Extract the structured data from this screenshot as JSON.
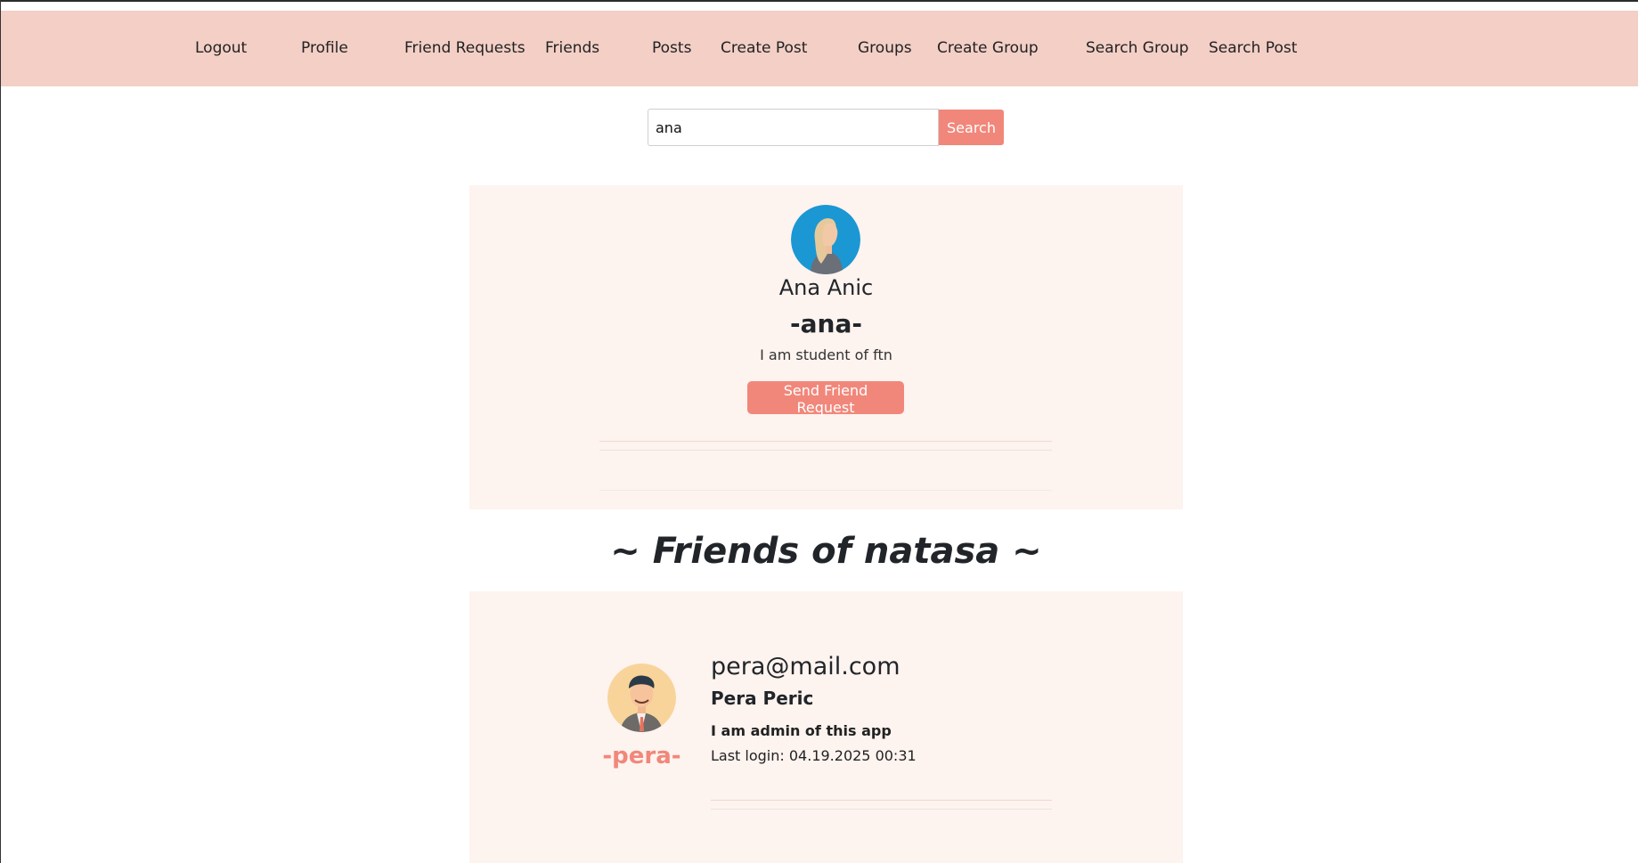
{
  "navbar": {
    "items": [
      {
        "label": "Logout"
      },
      {
        "label": "Profile"
      },
      {
        "label": "Friend Requests"
      },
      {
        "label": "Friends"
      },
      {
        "label": "Posts"
      },
      {
        "label": "Create Post"
      },
      {
        "label": "Groups"
      },
      {
        "label": "Create Group"
      },
      {
        "label": "Search Group"
      },
      {
        "label": "Search Post"
      }
    ],
    "background": "#f3cfc6"
  },
  "search": {
    "value": "ana",
    "button_label": "Search"
  },
  "result": {
    "full_name": "Ana Anic",
    "username": "-ana-",
    "bio": "I am student of ftn",
    "action_label": "Send Friend Request",
    "avatar_icon": "woman-avatar-icon"
  },
  "friends_section": {
    "title": "~ Friends of natasa ~",
    "friends": [
      {
        "email": "pera@mail.com",
        "full_name": "Pera Peric",
        "bio": "I am admin of this app",
        "last_login": "Last login: 04.19.2025 00:31",
        "username": "-pera-",
        "avatar_icon": "man-avatar-icon"
      }
    ]
  },
  "colors": {
    "accent": "#f1877a",
    "card_bg": "#fdf3ef"
  }
}
